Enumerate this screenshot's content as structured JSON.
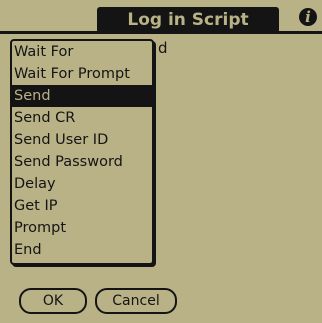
{
  "titlebar": {
    "title": "Log in Script",
    "info_icon": "i"
  },
  "background": {
    "partial_text": "d"
  },
  "command_menu": {
    "selected": "Send",
    "items": [
      "Wait For",
      "Wait For Prompt",
      "Send",
      "Send CR",
      "Send User ID",
      "Send Password",
      "Delay",
      "Get IP",
      "Prompt",
      "End"
    ]
  },
  "buttons": {
    "ok_label": "OK",
    "cancel_label": "Cancel"
  },
  "colors": {
    "screen": "#b9b286",
    "ink": "#141414"
  }
}
